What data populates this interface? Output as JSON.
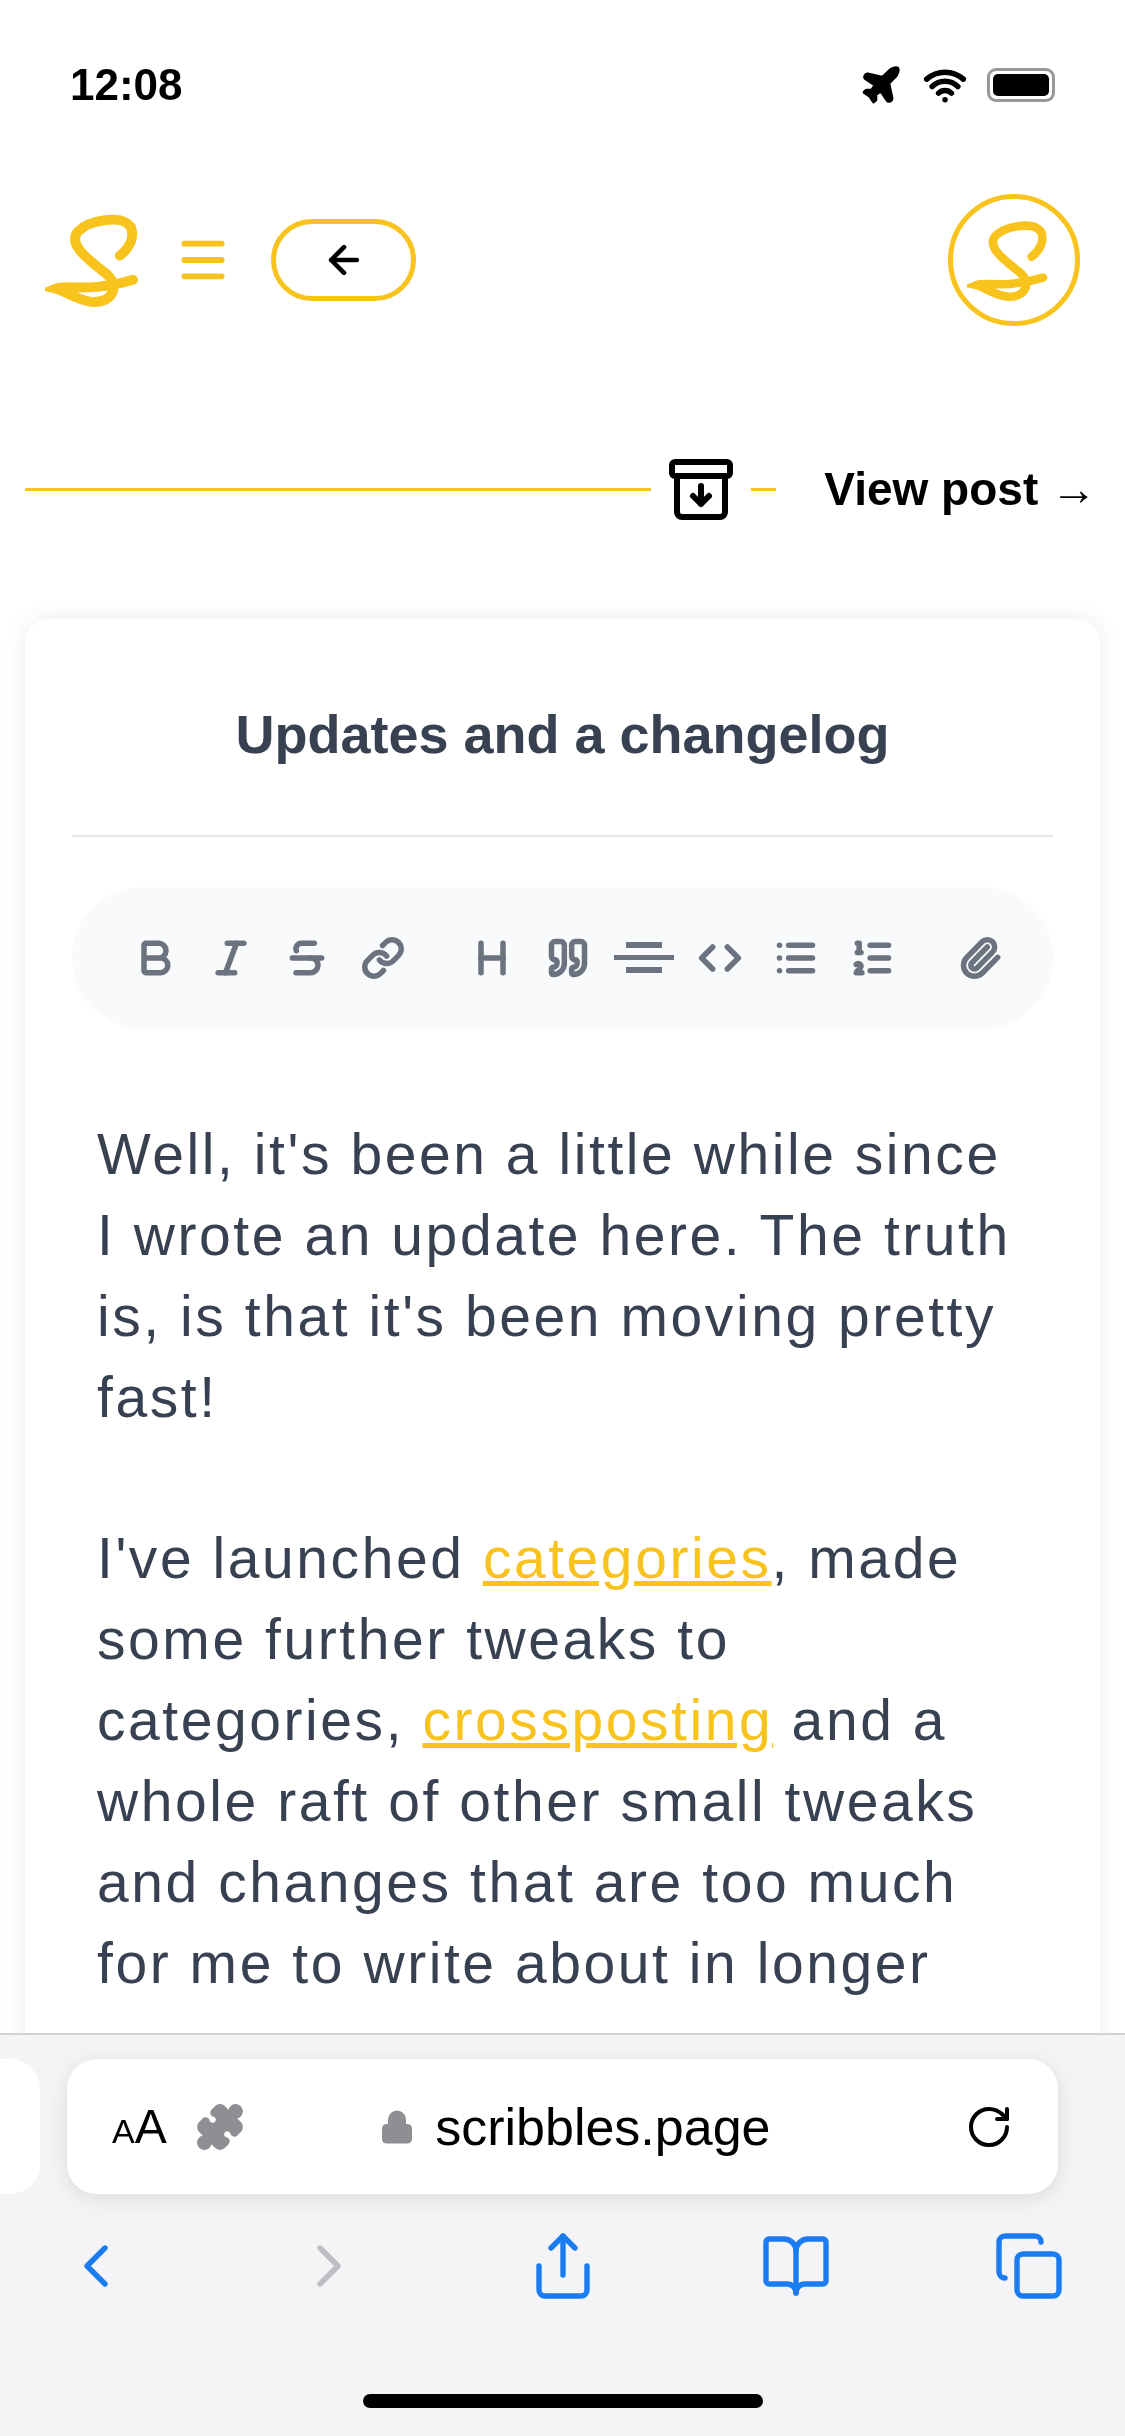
{
  "status_bar": {
    "time": "12:08"
  },
  "post_bar": {
    "view_post": "View post →"
  },
  "editor": {
    "title": "Updates and a changelog",
    "paragraphs": [
      [
        {
          "kind": "text",
          "text": "Well, it's been a little while since I wrote an update here. The truth is, is that it's been moving pretty fast!"
        }
      ],
      [
        {
          "kind": "text",
          "text": "I've launched "
        },
        {
          "kind": "link",
          "text": "categories"
        },
        {
          "kind": "text",
          "text": ", made some further tweaks to categories, "
        },
        {
          "kind": "link",
          "text": "crossposting"
        },
        {
          "kind": "text",
          "text": " and a whole raft of other small tweaks and changes that are too much for me to write about in longer"
        }
      ]
    ]
  },
  "browser": {
    "text_size": "AA",
    "url": "scribbles.page",
    "nav": [
      {
        "kind": "back",
        "disabled": false
      },
      {
        "kind": "forward",
        "disabled": true
      },
      {
        "kind": "share",
        "disabled": false
      },
      {
        "kind": "bookmarks",
        "disabled": false
      },
      {
        "kind": "tabs",
        "disabled": false
      }
    ]
  }
}
